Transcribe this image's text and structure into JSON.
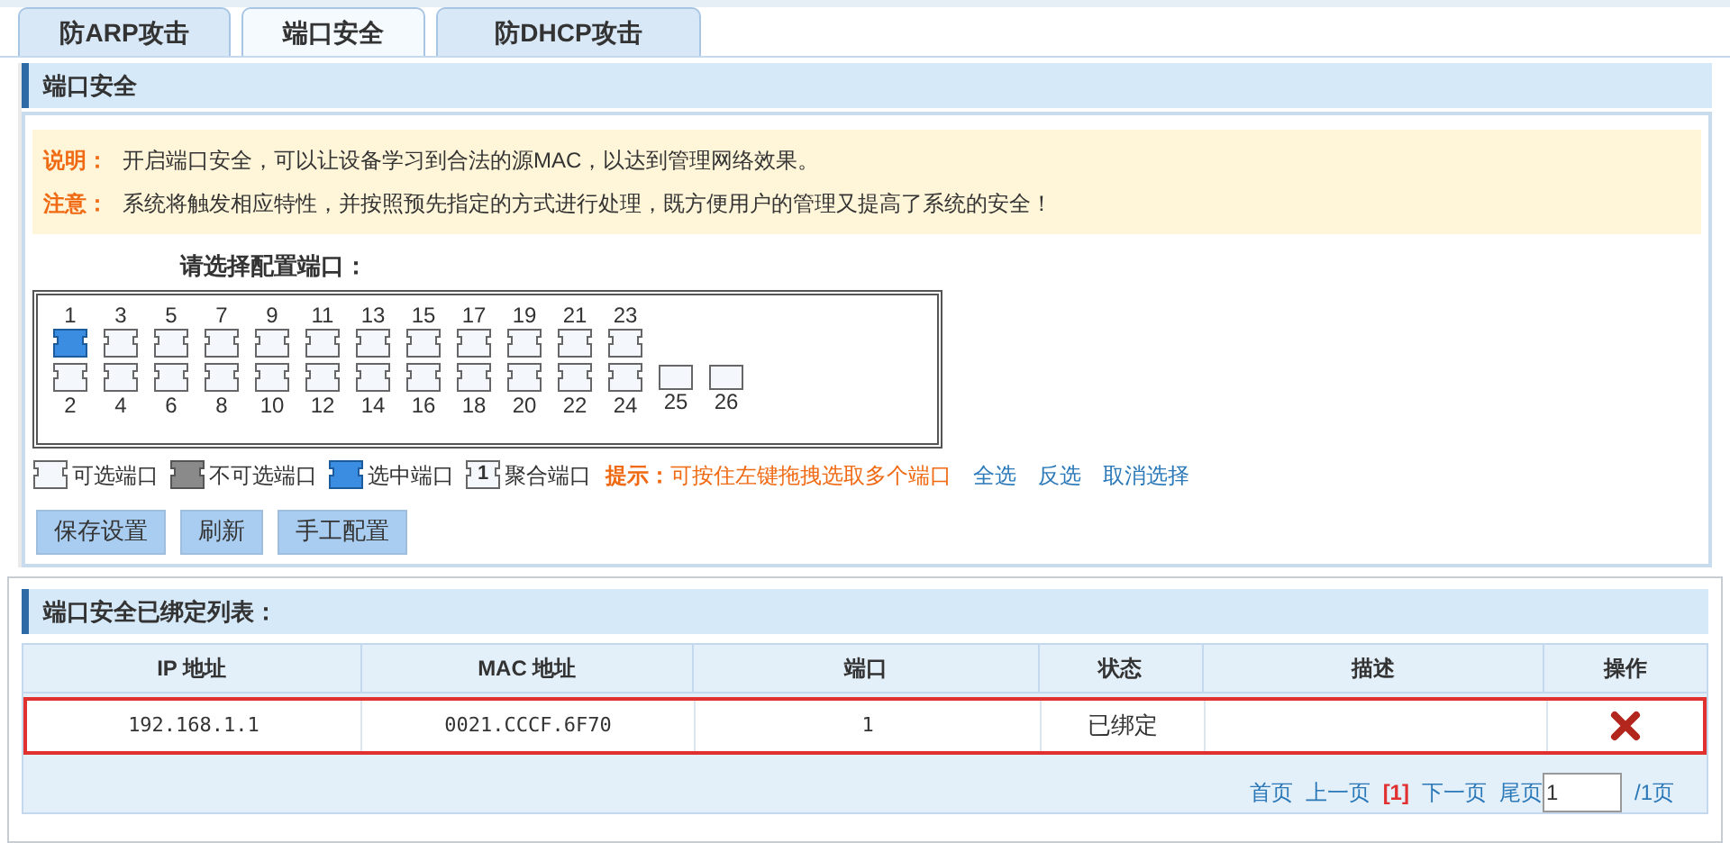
{
  "tabs": [
    {
      "label": "防ARP攻击",
      "selected": false
    },
    {
      "label": "端口安全",
      "selected": true
    },
    {
      "label": "防DHCP攻击",
      "selected": false
    }
  ],
  "section_title": "端口安全",
  "notice": [
    {
      "label": "说明：",
      "text": "开启端口安全，可以让设备学习到合法的源MAC，以达到管理网络效果。"
    },
    {
      "label": "注意：",
      "text": "系统将触发相应特性，并按照预先指定的方式进行处理，既方便用户的管理又提高了系统的安全！"
    }
  ],
  "port_prompt": "请选择配置端口：",
  "ports": [
    {
      "label": "1",
      "selected": true,
      "kind": "copper"
    },
    {
      "label": "2",
      "selected": false,
      "kind": "copper"
    },
    {
      "label": "3",
      "selected": false,
      "kind": "copper"
    },
    {
      "label": "4",
      "selected": false,
      "kind": "copper"
    },
    {
      "label": "5",
      "selected": false,
      "kind": "copper"
    },
    {
      "label": "6",
      "selected": false,
      "kind": "copper"
    },
    {
      "label": "7",
      "selected": false,
      "kind": "copper"
    },
    {
      "label": "8",
      "selected": false,
      "kind": "copper"
    },
    {
      "label": "9",
      "selected": false,
      "kind": "copper"
    },
    {
      "label": "10",
      "selected": false,
      "kind": "copper"
    },
    {
      "label": "11",
      "selected": false,
      "kind": "copper"
    },
    {
      "label": "12",
      "selected": false,
      "kind": "copper"
    },
    {
      "label": "13",
      "selected": false,
      "kind": "copper"
    },
    {
      "label": "14",
      "selected": false,
      "kind": "copper"
    },
    {
      "label": "15",
      "selected": false,
      "kind": "copper"
    },
    {
      "label": "16",
      "selected": false,
      "kind": "copper"
    },
    {
      "label": "17",
      "selected": false,
      "kind": "copper"
    },
    {
      "label": "18",
      "selected": false,
      "kind": "copper"
    },
    {
      "label": "19",
      "selected": false,
      "kind": "copper"
    },
    {
      "label": "20",
      "selected": false,
      "kind": "copper"
    },
    {
      "label": "21",
      "selected": false,
      "kind": "copper"
    },
    {
      "label": "22",
      "selected": false,
      "kind": "copper"
    },
    {
      "label": "23",
      "selected": false,
      "kind": "copper"
    },
    {
      "label": "24",
      "selected": false,
      "kind": "copper"
    },
    {
      "label": "25",
      "selected": false,
      "kind": "fiber"
    },
    {
      "label": "26",
      "selected": false,
      "kind": "fiber"
    }
  ],
  "legend": [
    {
      "kind": "available",
      "label": "可选端口"
    },
    {
      "kind": "unavailable",
      "label": "不可选端口"
    },
    {
      "kind": "selected",
      "label": "选中端口"
    },
    {
      "kind": "aggregated",
      "label": "聚合端口",
      "badge": "1"
    }
  ],
  "hint": {
    "label": "提示：",
    "text": "可按住左键拖拽选取多个端口"
  },
  "select_links": [
    "全选",
    "反选",
    "取消选择"
  ],
  "buttons": [
    "保存设置",
    "刷新",
    "手工配置"
  ],
  "list_title": "端口安全已绑定列表：",
  "table": {
    "columns": [
      "IP 地址",
      "MAC 地址",
      "端口",
      "状态",
      "描述",
      "操作"
    ],
    "rows": [
      {
        "ip": "192.168.1.1",
        "mac": "0021.CCCF.6F70",
        "port": "1",
        "status": "已绑定",
        "highlighted": true
      }
    ]
  },
  "pagination": {
    "first": "首页",
    "prev": "上一页",
    "current": "[1]",
    "next": "下一页",
    "last": "尾页",
    "page_value": "1",
    "total": "/1页"
  }
}
